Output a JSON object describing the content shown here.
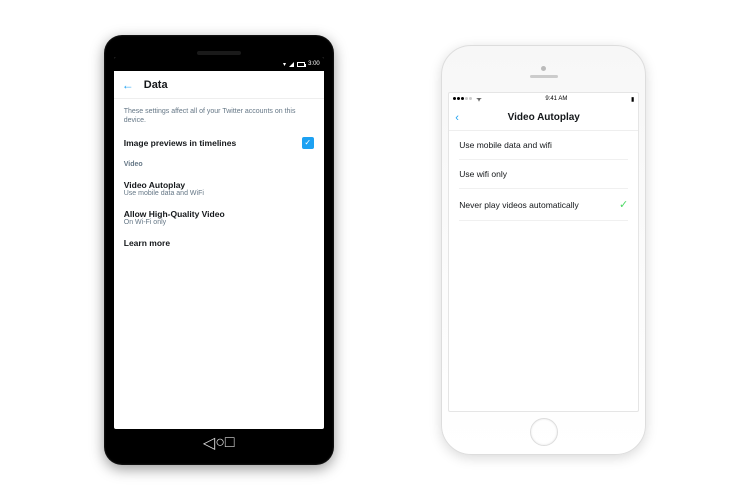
{
  "android": {
    "statusbar_time": "3:00",
    "title": "Data",
    "intro": "These settings affect all of your Twitter accounts on this device.",
    "image_previews_label": "Image previews in timelines",
    "section_video": "Video",
    "video_autoplay": {
      "title": "Video Autoplay",
      "subtitle": "Use mobile data and WiFi"
    },
    "high_quality": {
      "title": "Allow High-Quality Video",
      "subtitle": "On Wi-Fi only"
    },
    "learn_more": "Learn more"
  },
  "ios": {
    "statusbar_time": "9:41 AM",
    "carrier": "",
    "title": "Video Autoplay",
    "option1": "Use mobile data and wifi",
    "option2": "Use wifi only",
    "option3": "Never play videos automatically",
    "selected_index": 2
  }
}
